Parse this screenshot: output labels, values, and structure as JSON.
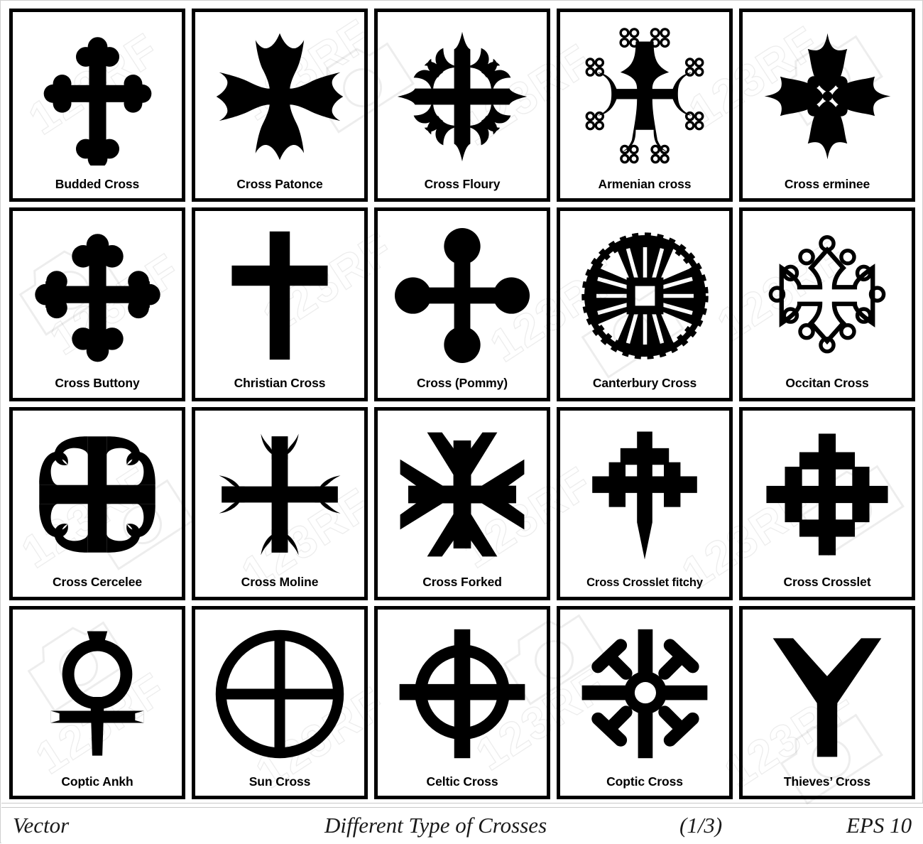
{
  "meta": {
    "title": "Different Type of Crosses",
    "colors": {
      "ink": "#000000",
      "paper": "#ffffff",
      "frame": "#cfcfcf"
    }
  },
  "footer": {
    "vector_label": "Vector",
    "title": "Different Type of Crosses",
    "page_indicator": "(1/3)",
    "format_label": "EPS 10"
  },
  "watermark": {
    "text": "123RF"
  },
  "grid": {
    "rows": 4,
    "columns": 5,
    "cells": [
      {
        "label": "Budded Cross",
        "icon": "budded-cross-icon"
      },
      {
        "label": "Cross Patonce",
        "icon": "cross-patonce-icon"
      },
      {
        "label": "Cross Floury",
        "icon": "cross-floury-icon"
      },
      {
        "label": "Armenian cross",
        "icon": "armenian-cross-icon"
      },
      {
        "label": "Cross erminee",
        "icon": "cross-erminee-icon"
      },
      {
        "label": "Cross Buttony",
        "icon": "cross-buttony-icon"
      },
      {
        "label": "Christian Cross",
        "icon": "christian-cross-icon"
      },
      {
        "label": "Cross (Pommy)",
        "icon": "cross-pommy-icon"
      },
      {
        "label": "Canterbury Cross",
        "icon": "canterbury-cross-icon"
      },
      {
        "label": "Occitan Cross",
        "icon": "occitan-cross-icon"
      },
      {
        "label": "Cross Cercelee",
        "icon": "cross-cercelee-icon"
      },
      {
        "label": "Cross Moline",
        "icon": "cross-moline-icon"
      },
      {
        "label": "Cross Forked",
        "icon": "cross-forked-icon"
      },
      {
        "label": "Cross Crosslet fitchy",
        "icon": "cross-crosslet-fitchy-icon"
      },
      {
        "label": "Cross Crosslet",
        "icon": "cross-crosslet-icon"
      },
      {
        "label": "Coptic Ankh",
        "icon": "coptic-ankh-icon"
      },
      {
        "label": "Sun Cross",
        "icon": "sun-cross-icon"
      },
      {
        "label": "Celtic Cross",
        "icon": "celtic-cross-icon"
      },
      {
        "label": "Coptic Cross",
        "icon": "coptic-cross-icon"
      },
      {
        "label": "Thieves’ Cross",
        "icon": "thieves-cross-icon"
      }
    ]
  }
}
